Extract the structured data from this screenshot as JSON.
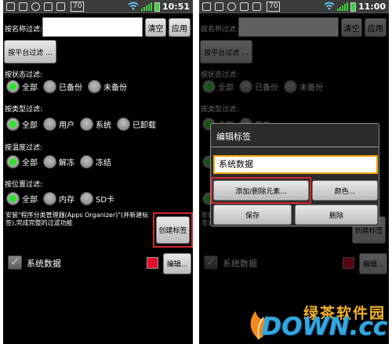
{
  "statusbar": {
    "badge": "70",
    "left_time": "10:51",
    "right_time": "11:00"
  },
  "filters": {
    "name_label": "按名称过滤:",
    "name_value": "",
    "clear_button": "清空",
    "apply_button": "应用",
    "platform_button": "按平台过滤 ...",
    "status_label": "按状态过滤:",
    "status_options": [
      "全部",
      "已备份",
      "未备份"
    ],
    "type_label": "按类型过滤:",
    "type_options": [
      "全部",
      "用户",
      "系统",
      "已卸载"
    ],
    "temp_label": "按温度过滤:",
    "temp_options": [
      "全部",
      "解冻",
      "冻结"
    ],
    "location_label": "按位置过滤:",
    "location_options": [
      "全部",
      "内存",
      "SD卡"
    ]
  },
  "hint_text": "安装\"程序分类管理器(Apps Organizer)\"(并新建标签),完成完整的过滤功能",
  "create_tag_button": "创建标签",
  "tag_row": {
    "checkmark": "✓",
    "name": "系统数据",
    "edit_button": "编辑...",
    "swatch_color": "#e0102a"
  },
  "dialog": {
    "title": "编辑标签",
    "input_value": "系统数据",
    "add_remove_button": "添加/删除元素...",
    "color_button": "颜色...",
    "save_button": "保存",
    "delete_button": "删除"
  },
  "watermark": {
    "top": "绿茶软件园",
    "bottom": "DOWN.cc"
  },
  "colors": {
    "radio_on": "#2fe02f",
    "highlight_border": "#d3262b",
    "dialog_input_border": "#f3a20c"
  }
}
